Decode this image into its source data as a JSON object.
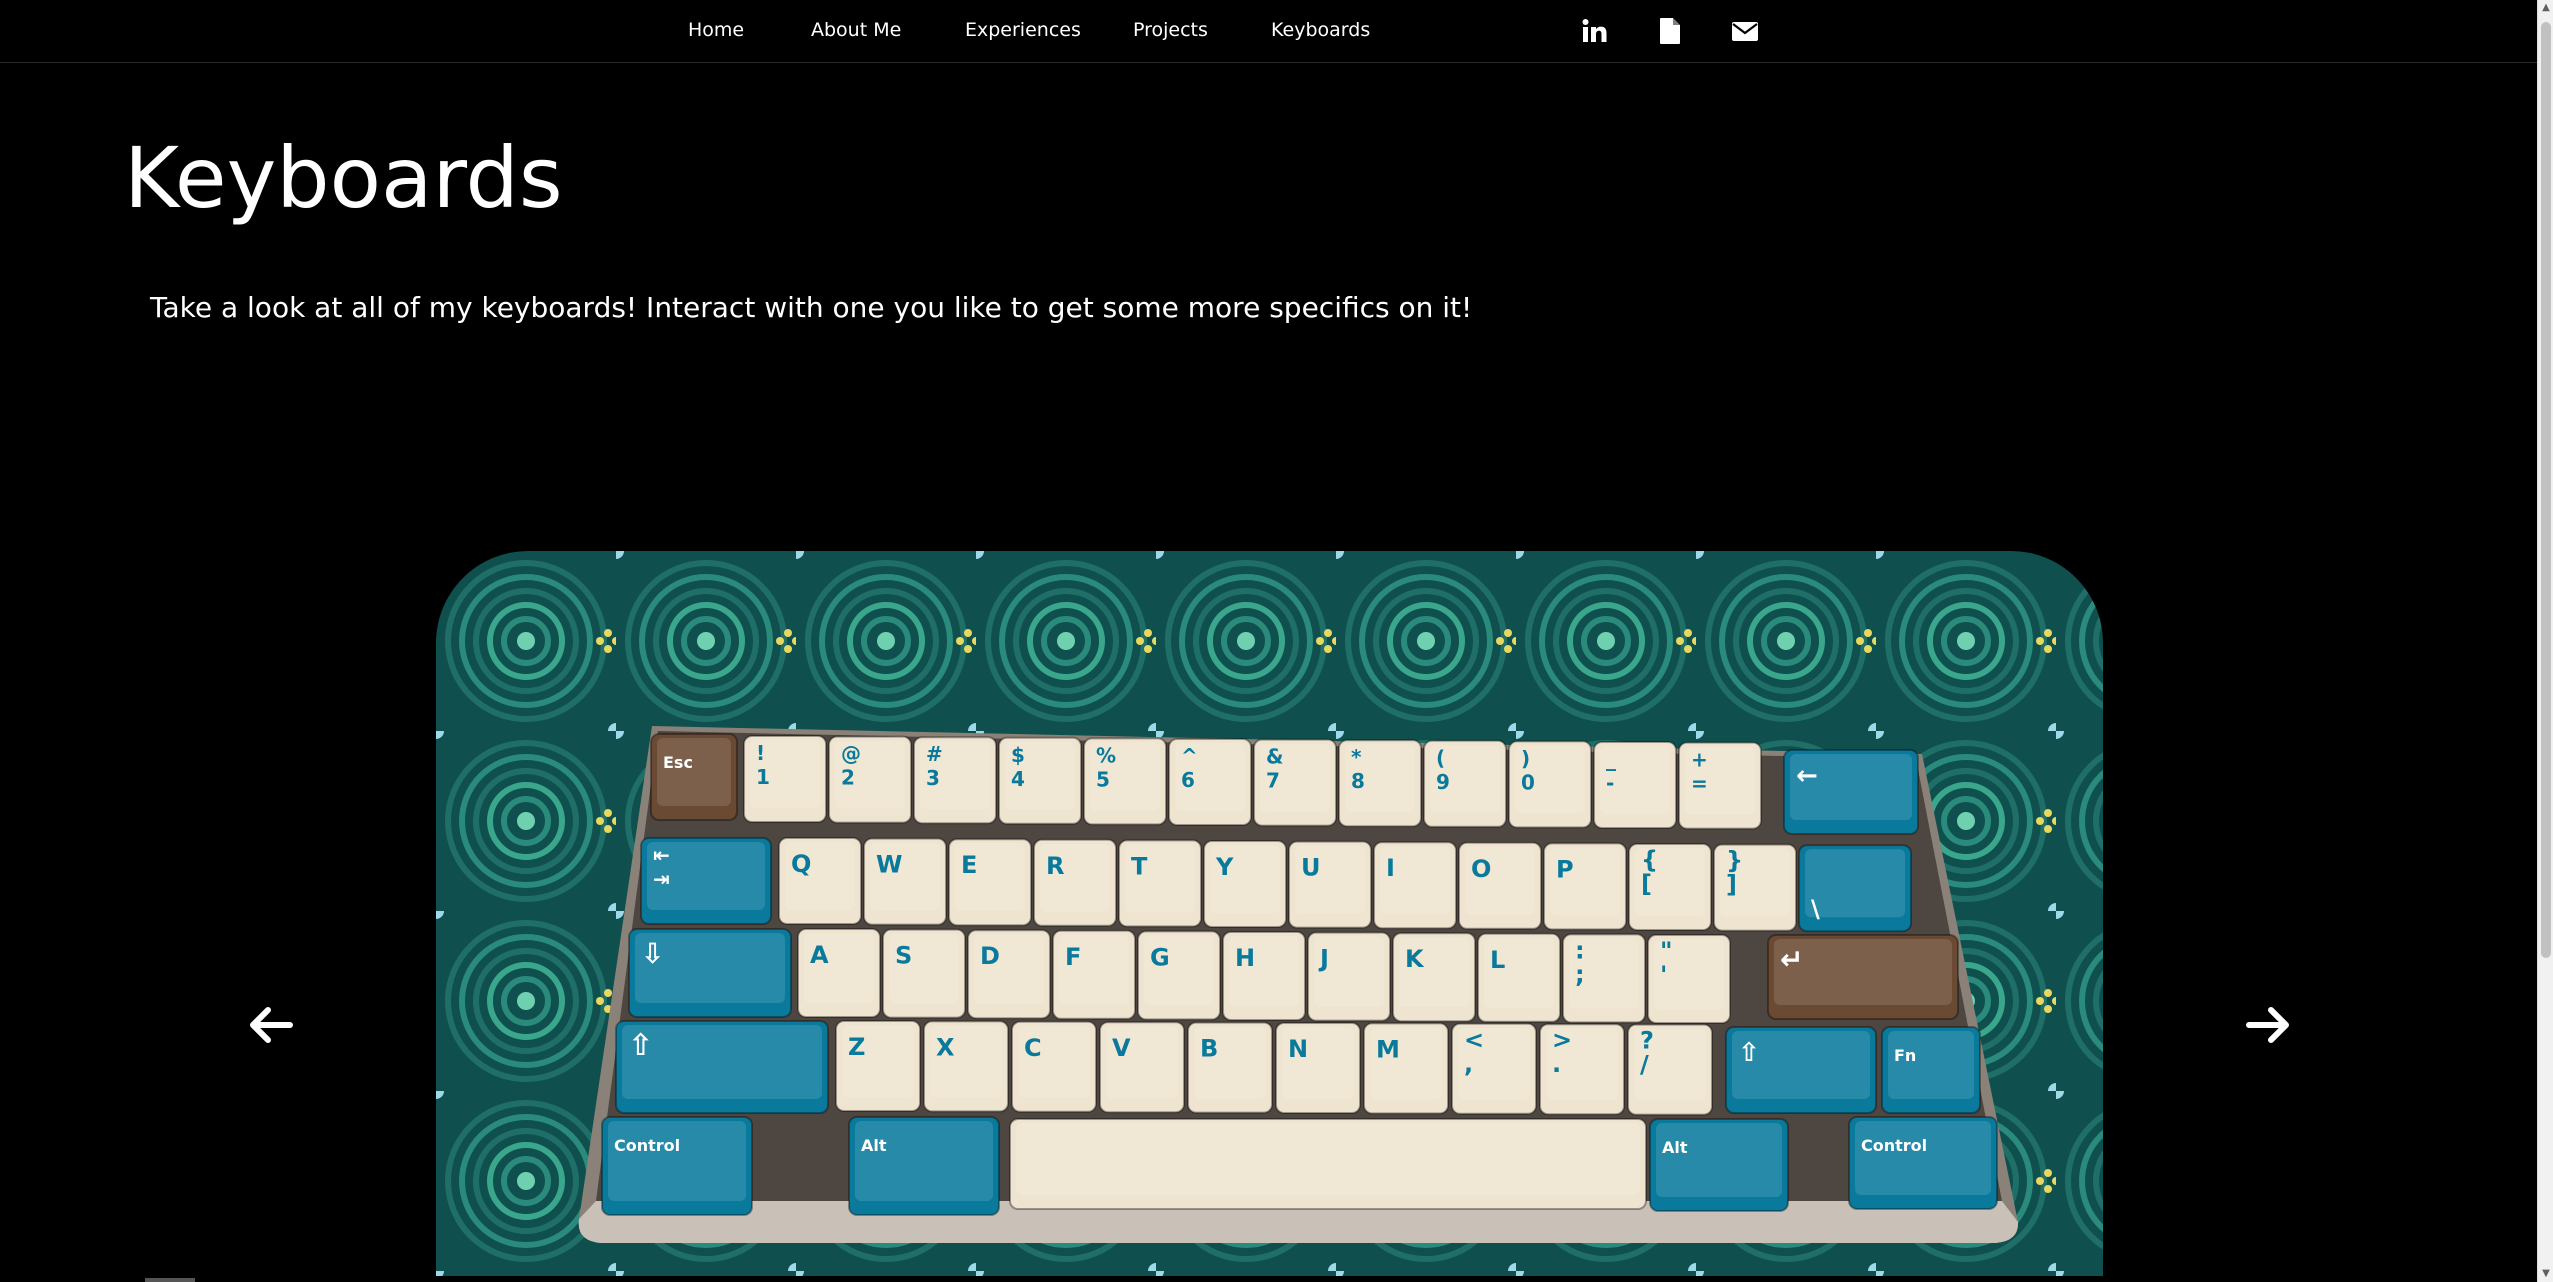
{
  "nav": {
    "links": [
      "Home",
      "About Me",
      "Experiences",
      "Projects",
      "Keyboards"
    ],
    "icons": [
      "linkedin-icon",
      "document-icon",
      "envelope-icon"
    ]
  },
  "header": {
    "title": "Keyboards",
    "intro": "Take a look at all of my keyboards! Interact with one you like to get some more specifics on it!"
  },
  "carousel": {
    "prev_icon": "arrow-left-icon",
    "next_icon": "arrow-right-icon",
    "slide": {
      "subject": "keyboard-photo",
      "keys": {
        "esc": "Esc",
        "numbers": [
          "!|1",
          "@|2",
          "#|3",
          "$|4",
          "%|5",
          "^|6",
          "&|7",
          "*|8",
          "(|9",
          ")|0",
          "_|-",
          "+|="
        ],
        "row_q": [
          "Q",
          "W",
          "E",
          "R",
          "T",
          "Y",
          "U",
          "I",
          "O",
          "P",
          "{|[",
          "}|]",
          "||\\"
        ],
        "row_a": [
          "A",
          "S",
          "D",
          "F",
          "G",
          "H",
          "J",
          "K",
          "L",
          ":|;",
          "\"|'"
        ],
        "row_z": [
          "Z",
          "X",
          "C",
          "V",
          "B",
          "N",
          "M",
          "<|,",
          ">|.",
          "?|/"
        ],
        "fn": "Fn",
        "control": "Control",
        "alt": "Alt"
      }
    }
  },
  "colors": {
    "background": "#000000",
    "text": "#ffffff",
    "key_blue": "#0a7a9c",
    "key_cream": "#efe4d0",
    "key_brown": "#6b4a33",
    "mat_teal": "#0f5a58"
  }
}
